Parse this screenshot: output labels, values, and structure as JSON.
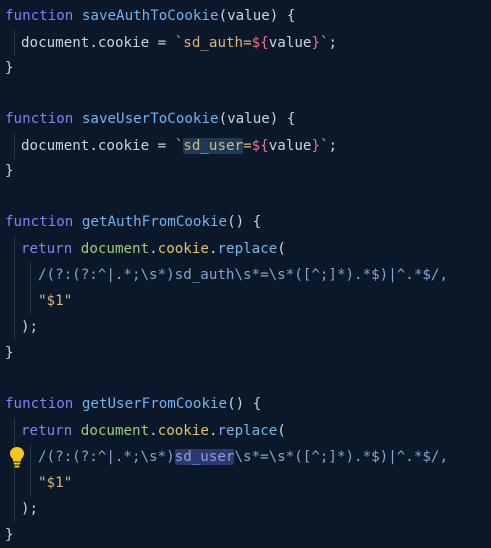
{
  "code": {
    "f1_kw": "function",
    "f1_name": "saveAuthToCookie",
    "f1_sig": "(value) {",
    "f1_b1": "document.",
    "f1_b2": "cookie",
    "f1_b3": " = ",
    "f1_t1": "`",
    "f1_t2": "sd_auth=",
    "f1_t3": "${",
    "f1_t4": "value",
    "f1_t5": "}",
    "f1_t6": "`",
    "f1_end": ";",
    "f1_close": "}",
    "f2_kw": "function",
    "f2_name": "saveUserToCookie",
    "f2_sig": "(value) {",
    "f2_b1": "document.",
    "f2_b2": "cookie",
    "f2_b3": " = ",
    "f2_t1": "`",
    "f2_t2": "sd_user",
    "f2_t2b": "=",
    "f2_t3": "${",
    "f2_t4": "value",
    "f2_t5": "}",
    "f2_t6": "`",
    "f2_end": ";",
    "f2_close": "}",
    "f3_kw": "function",
    "f3_name": "getAuthFromCookie",
    "f3_sig": "() {",
    "f3_ret": "return",
    "f3_obj": "document",
    "f3_dot1": ".",
    "f3_prop": "cookie",
    "f3_dot2": ".",
    "f3_mth": "replace",
    "f3_paren": "(",
    "f3_rx": "/(?:(?:^|.*;\\s*)sd_auth\\s*=\\s*([^;]*).*$)|^.*$/,",
    "f3_str": "\"$1\"",
    "f3_closeparen": ");",
    "f3_close": "}",
    "f4_kw": "function",
    "f4_name": "getUserFromCookie",
    "f4_sig": "() {",
    "f4_ret": "return",
    "f4_obj": "document",
    "f4_dot1": ".",
    "f4_prop": "cookie",
    "f4_dot2": ".",
    "f4_mth": "replace",
    "f4_paren": "(",
    "f4_rx1": "/(?:(?:^|.*;\\s*)",
    "f4_rx2": "sd_user",
    "f4_rx3": "\\s*=\\s*([^;]*).*$)|^.*$/,",
    "f4_str": "\"$1\"",
    "f4_closeparen": ");",
    "f4_close": "}"
  },
  "icons": {
    "lightbulb": "lightbulb-icon"
  },
  "colors": {
    "background": "#0b1829",
    "keyword": "#8d7cf2",
    "function": "#6fb3f2",
    "string": "#d8b57a"
  }
}
